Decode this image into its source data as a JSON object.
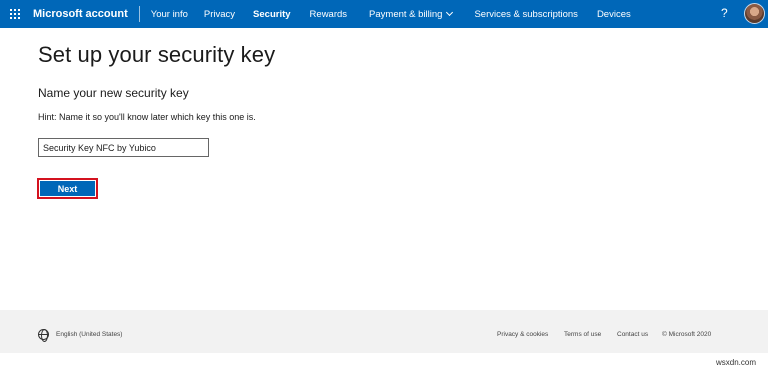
{
  "header": {
    "brand": "Microsoft account",
    "nav": [
      {
        "label": "Your info"
      },
      {
        "label": "Privacy"
      },
      {
        "label": "Security",
        "active": true
      },
      {
        "label": "Rewards"
      },
      {
        "label": "Payment & billing",
        "has_dropdown": true
      },
      {
        "label": "Services & subscriptions"
      },
      {
        "label": "Devices"
      }
    ],
    "help": "?"
  },
  "main": {
    "title": "Set up your security key",
    "subtitle": "Name your new security key",
    "hint": "Hint: Name it so you'll know later which key this one is.",
    "key_name_value": "Security Key NFC by Yubico",
    "next_label": "Next"
  },
  "footer": {
    "locale": "English (United States)",
    "links": [
      "Privacy & cookies",
      "Terms of use",
      "Contact us",
      "© Microsoft 2020"
    ]
  },
  "watermark": "wsxdn.com",
  "colors": {
    "accent": "#0067b8",
    "highlight": "#d4121f",
    "footer_bg": "#f2f2f2"
  }
}
